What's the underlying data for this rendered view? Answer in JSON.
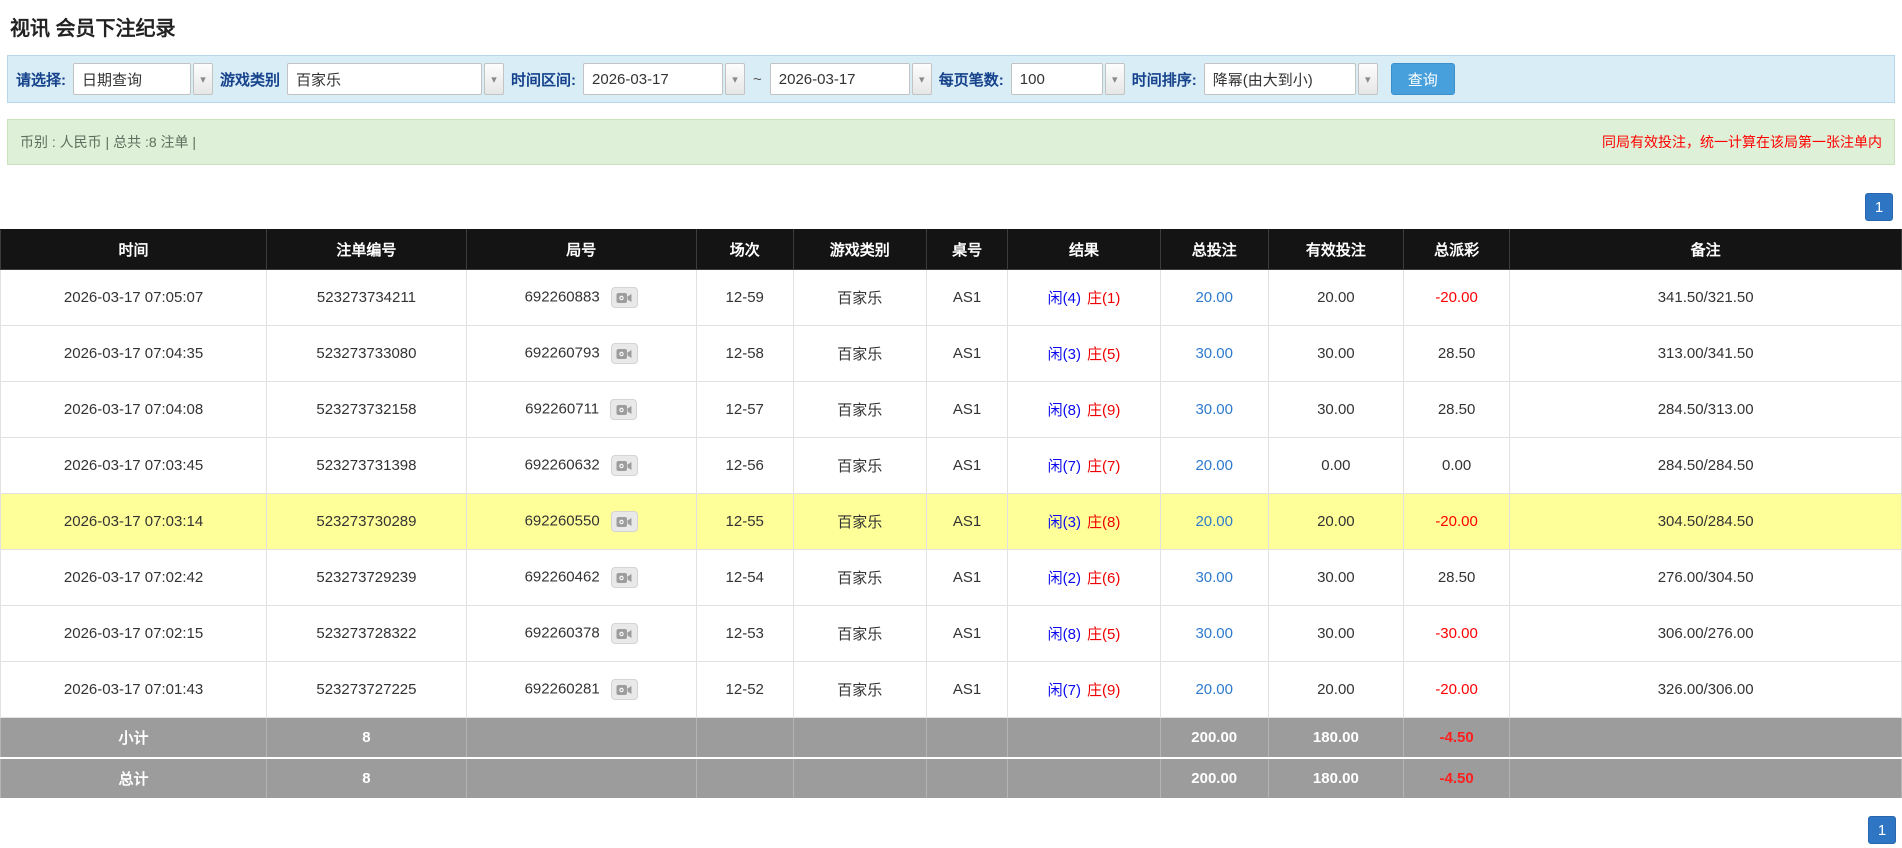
{
  "page": {
    "title": "视讯 会员下注纪录"
  },
  "icons": {
    "dropdown_arrow": "▾"
  },
  "filters": {
    "select_label": "请选择:",
    "select_value": "日期查询",
    "game_type_label": "游戏类别",
    "game_type_value": "百家乐",
    "time_range_label": "时间区间:",
    "date_from": "2026-03-17",
    "range_separator": "~",
    "date_to": "2026-03-17",
    "page_size_label": "每页笔数:",
    "page_size_value": "100",
    "sort_label": "时间排序:",
    "sort_value": "降幂(由大到小)",
    "search_button_label": "查询"
  },
  "summary": {
    "left_text": "币别 : 人民币 | 总共 :8 注单 |",
    "right_notice": "同局有效投注，统一计算在该局第一张注单内"
  },
  "pagination": {
    "current_page": "1"
  },
  "table": {
    "headers": [
      "时间",
      "注单编号",
      "局号",
      "场次",
      "游戏类别",
      "桌号",
      "结果",
      "总投注",
      "有效投注",
      "总派彩",
      "备注"
    ],
    "rows": [
      {
        "time": "2026-03-17 07:05:07",
        "bet_id": "523273734211",
        "round_id": "692260883",
        "session": "12-59",
        "game_type": "百家乐",
        "table_no": "AS1",
        "result_player": "闲(4)",
        "result_banker": "庄(1)",
        "total_bet": "20.00",
        "valid_bet": "20.00",
        "payout": "-20.00",
        "remark": "341.50/321.50",
        "highlighted": false
      },
      {
        "time": "2026-03-17 07:04:35",
        "bet_id": "523273733080",
        "round_id": "692260793",
        "session": "12-58",
        "game_type": "百家乐",
        "table_no": "AS1",
        "result_player": "闲(3)",
        "result_banker": "庄(5)",
        "total_bet": "30.00",
        "valid_bet": "30.00",
        "payout": "28.50",
        "remark": "313.00/341.50",
        "highlighted": false
      },
      {
        "time": "2026-03-17 07:04:08",
        "bet_id": "523273732158",
        "round_id": "692260711",
        "session": "12-57",
        "game_type": "百家乐",
        "table_no": "AS1",
        "result_player": "闲(8)",
        "result_banker": "庄(9)",
        "total_bet": "30.00",
        "valid_bet": "30.00",
        "payout": "28.50",
        "remark": "284.50/313.00",
        "highlighted": false
      },
      {
        "time": "2026-03-17 07:03:45",
        "bet_id": "523273731398",
        "round_id": "692260632",
        "session": "12-56",
        "game_type": "百家乐",
        "table_no": "AS1",
        "result_player": "闲(7)",
        "result_banker": "庄(7)",
        "total_bet": "20.00",
        "valid_bet": "0.00",
        "payout": "0.00",
        "remark": "284.50/284.50",
        "highlighted": false
      },
      {
        "time": "2026-03-17 07:03:14",
        "bet_id": "523273730289",
        "round_id": "692260550",
        "session": "12-55",
        "game_type": "百家乐",
        "table_no": "AS1",
        "result_player": "闲(3)",
        "result_banker": "庄(8)",
        "total_bet": "20.00",
        "valid_bet": "20.00",
        "payout": "-20.00",
        "remark": "304.50/284.50",
        "highlighted": true
      },
      {
        "time": "2026-03-17 07:02:42",
        "bet_id": "523273729239",
        "round_id": "692260462",
        "session": "12-54",
        "game_type": "百家乐",
        "table_no": "AS1",
        "result_player": "闲(2)",
        "result_banker": "庄(6)",
        "total_bet": "30.00",
        "valid_bet": "30.00",
        "payout": "28.50",
        "remark": "276.00/304.50",
        "highlighted": false
      },
      {
        "time": "2026-03-17 07:02:15",
        "bet_id": "523273728322",
        "round_id": "692260378",
        "session": "12-53",
        "game_type": "百家乐",
        "table_no": "AS1",
        "result_player": "闲(8)",
        "result_banker": "庄(5)",
        "total_bet": "30.00",
        "valid_bet": "30.00",
        "payout": "-30.00",
        "remark": "306.00/276.00",
        "highlighted": false
      },
      {
        "time": "2026-03-17 07:01:43",
        "bet_id": "523273727225",
        "round_id": "692260281",
        "session": "12-52",
        "game_type": "百家乐",
        "table_no": "AS1",
        "result_player": "闲(7)",
        "result_banker": "庄(9)",
        "total_bet": "20.00",
        "valid_bet": "20.00",
        "payout": "-20.00",
        "remark": "326.00/306.00",
        "highlighted": false
      }
    ],
    "footer_rows": [
      {
        "label": "小计",
        "count": "8",
        "total_bet": "200.00",
        "valid_bet": "180.00",
        "payout": "-4.50"
      },
      {
        "label": "总计",
        "count": "8",
        "total_bet": "200.00",
        "valid_bet": "180.00",
        "payout": "-4.50"
      }
    ]
  }
}
